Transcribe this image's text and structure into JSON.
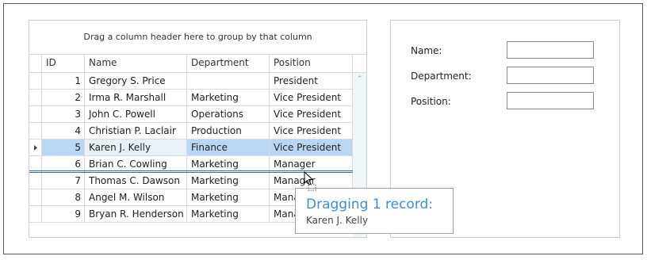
{
  "grid": {
    "group_panel_text": "Drag a column header here to group by that column",
    "columns": [
      "ID",
      "Name",
      "Department",
      "Position"
    ],
    "rows": [
      {
        "id": "1",
        "name": "Gregory S. Price",
        "department": "",
        "position": "President"
      },
      {
        "id": "2",
        "name": "Irma R. Marshall",
        "department": "Marketing",
        "position": "Vice President"
      },
      {
        "id": "3",
        "name": "John C. Powell",
        "department": "Operations",
        "position": "Vice President"
      },
      {
        "id": "4",
        "name": "Christian P. Laclair",
        "department": "Production",
        "position": "Vice President"
      },
      {
        "id": "5",
        "name": "Karen J. Kelly",
        "department": "Finance",
        "position": "Vice President"
      },
      {
        "id": "6",
        "name": "Brian C. Cowling",
        "department": "Marketing",
        "position": "Manager"
      },
      {
        "id": "7",
        "name": "Thomas C. Dawson",
        "department": "Marketing",
        "position": "Manager"
      },
      {
        "id": "8",
        "name": "Angel M. Wilson",
        "department": "Marketing",
        "position": "Manager"
      },
      {
        "id": "9",
        "name": "Bryan R. Henderson",
        "department": "Marketing",
        "position": "Manager"
      }
    ]
  },
  "form": {
    "name_label": "Name:",
    "department_label": "Department:",
    "position_label": "Position:",
    "name_value": "",
    "department_value": "",
    "position_value": ""
  },
  "drag_tooltip": {
    "title": "Dragging 1 record:",
    "record": "Karen J. Kelly"
  }
}
